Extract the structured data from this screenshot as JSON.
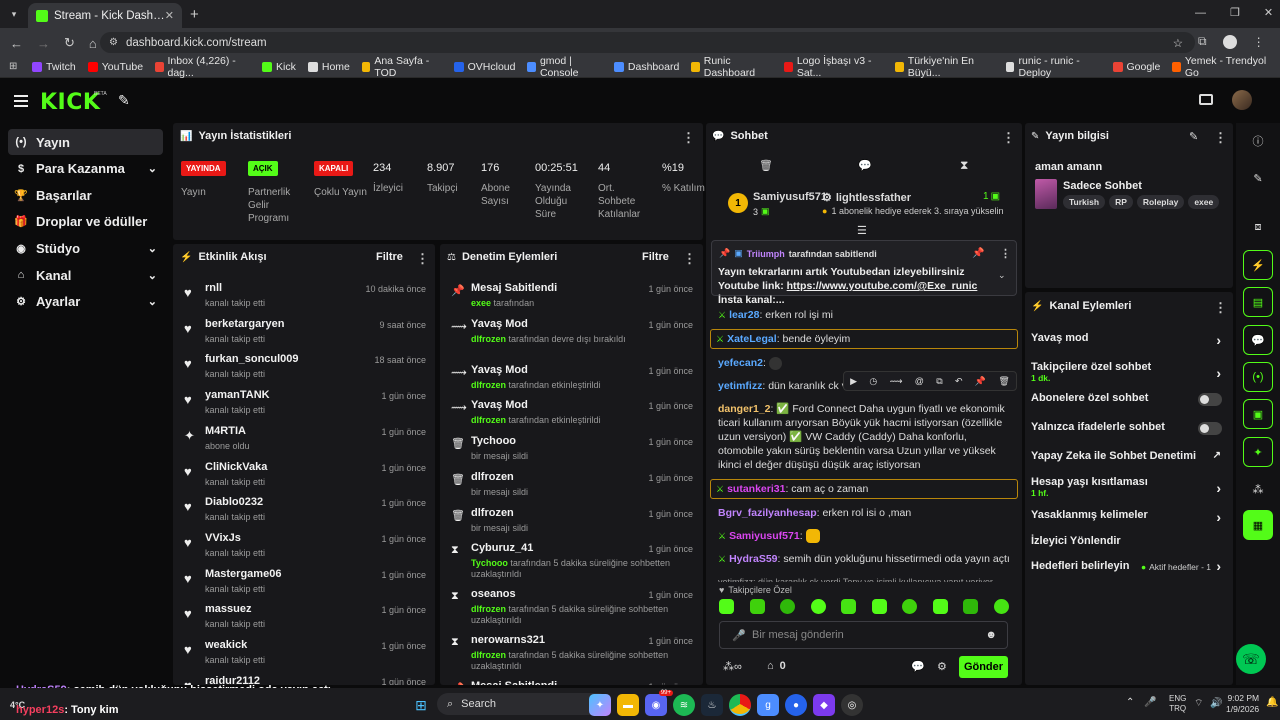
{
  "browser": {
    "tab_title": "Stream - Kick Dashboard",
    "url": "dashboard.kick.com/stream",
    "bookmarks": [
      "Twitch",
      "YouTube",
      "Inbox (4,226) - dag...",
      "Kick",
      "Home",
      "Ana Sayfa - TOD",
      "OVHcloud",
      "gmod | Console",
      "Dashboard",
      "Runic Dashboard",
      "Logo İşbaşı v3 - Sat...",
      "Türkiye'nin En Büyü...",
      "runic - runic - Deploy",
      "Google",
      "Yemek - Trendyol Go"
    ]
  },
  "kick": {
    "logo": "KICK",
    "beta": "BETA"
  },
  "sidebar": {
    "items": [
      {
        "label": "Yayın",
        "icon": "(•)"
      },
      {
        "label": "Para Kazanma",
        "icon": "$"
      },
      {
        "label": "Başarılar",
        "icon": "🏆"
      },
      {
        "label": "Droplar ve ödüller",
        "icon": "🎁"
      },
      {
        "label": "Stüdyo",
        "icon": "◉"
      },
      {
        "label": "Kanal",
        "icon": "⌂"
      },
      {
        "label": "Ayarlar",
        "icon": "⚙"
      }
    ]
  },
  "stats": {
    "title": "Yayın İstatistikleri",
    "badges": [
      {
        "badge": "YAYINDA",
        "label": "Yayın",
        "color": "#e91916",
        "text": "#fff"
      },
      {
        "badge": "AÇIK",
        "label": "Partnerlik Gelir Programı",
        "color": "#53fc18",
        "text": "#000"
      },
      {
        "badge": "KAPALI",
        "label": "Çoklu Yayın",
        "color": "#e91916",
        "text": "#fff"
      }
    ],
    "values": [
      {
        "value": "234",
        "label": "İzleyici"
      },
      {
        "value": "8.907",
        "label": "Takipçi"
      },
      {
        "value": "176",
        "label": "Abone Sayısı"
      },
      {
        "value": "00:25:51",
        "label": "Yayında Olduğu Süre"
      },
      {
        "value": "44",
        "label": "Ort. Sohbete Katılanlar"
      },
      {
        "value": "%19",
        "label": "% Katılım"
      }
    ]
  },
  "activity": {
    "title": "Etkinlik Akışı",
    "filter": "Filtre",
    "items": [
      {
        "name": "rnll",
        "sub": "kanalı takip etti",
        "time": "10 dakika önce"
      },
      {
        "name": "berketargaryen",
        "sub": "kanalı takip etti",
        "time": "9 saat önce"
      },
      {
        "name": "furkan_soncul009",
        "sub": "kanalı takip etti",
        "time": "18 saat önce"
      },
      {
        "name": "yamanTANK",
        "sub": "kanalı takip etti",
        "time": "1 gün önce"
      },
      {
        "name": "M4RTIA",
        "sub": "abone oldu",
        "time": "1 gün önce"
      },
      {
        "name": "CliNickVaka",
        "sub": "kanalı takip etti",
        "time": "1 gün önce"
      },
      {
        "name": "Diablo0232",
        "sub": "kanalı takip etti",
        "time": "1 gün önce"
      },
      {
        "name": "VVixJs",
        "sub": "kanalı takip etti",
        "time": "1 gün önce"
      },
      {
        "name": "Mastergame06",
        "sub": "kanalı takip etti",
        "time": "1 gün önce"
      },
      {
        "name": "massuez",
        "sub": "kanalı takip etti",
        "time": "1 gün önce"
      },
      {
        "name": "weakick",
        "sub": "kanalı takip etti",
        "time": "1 gün önce"
      },
      {
        "name": "raidur2112",
        "sub": "",
        "time": "1 gün önce"
      }
    ]
  },
  "moderation": {
    "title": "Denetim Eylemleri",
    "filter": "Filtre",
    "items": [
      {
        "icon": "pin",
        "title": "Mesaj Sabitlendi",
        "user": "exee",
        "sub": "tarafından",
        "time": "1 gün önce"
      },
      {
        "icon": "slow",
        "title": "Yavaş Mod",
        "user": "dlfrozen",
        "sub": "tarafından devre dışı bırakıldı",
        "time": "1 gün önce"
      },
      {
        "icon": "slow",
        "title": "Yavaş Mod",
        "user": "dlfrozen",
        "sub": "tarafından etkinleştirildi",
        "time": "1 gün önce"
      },
      {
        "icon": "slow",
        "title": "Yavaş Mod",
        "user": "dlfrozen",
        "sub": "tarafından etkinleştirildi",
        "time": "1 gün önce"
      },
      {
        "icon": "trash",
        "title": "Tychooo",
        "user": "",
        "sub": "bir mesajı sildi",
        "time": "1 gün önce"
      },
      {
        "icon": "trash",
        "title": "dlfrozen",
        "user": "",
        "sub": "bir mesajı sildi",
        "time": "1 gün önce"
      },
      {
        "icon": "trash",
        "title": "dlfrozen",
        "user": "",
        "sub": "bir mesajı sildi",
        "time": "1 gün önce"
      },
      {
        "icon": "hour",
        "title": "Cyburuz_41",
        "user": "Tychooo",
        "sub": "tarafından 5 dakika süreliğine sohbetten uzaklaştırıldı",
        "time": "1 gün önce"
      },
      {
        "icon": "hour",
        "title": "oseanos",
        "user": "dlfrozen",
        "sub": "tarafından 5 dakika süreliğine sohbetten uzaklaştırıldı",
        "time": "1 gün önce"
      },
      {
        "icon": "hour",
        "title": "nerowarns321",
        "user": "dlfrozen",
        "sub": "tarafından 5 dakika süreliğine sohbetten uzaklaştırıldı",
        "time": "1 gün önce"
      },
      {
        "icon": "pin",
        "title": "Mesaj Sabitlendi",
        "user": "",
        "sub": "",
        "time": "1 gün önce"
      }
    ]
  },
  "chat": {
    "title": "Sohbet",
    "gift": {
      "rank": "1",
      "user": "Samiyusuf571",
      "count": "3",
      "gifted": "lightlessfather",
      "gcount": "1",
      "text": "1 abonelik hediye ederek 3. sıraya yükselin"
    },
    "pinned": {
      "by": "Triiumph",
      "by_suffix": "tarafından sabitlendi",
      "text": "Yayın tekrarlarını artık Youtubedan izleyebilirsiniz Youtube link: ",
      "link": "https://www.youtube.com/@Exe_runic",
      "tail": " İnsta kanal:..."
    },
    "messages": [
      {
        "user": "lear28",
        "color": "#5aa9ff",
        "text": "erken rol işi mi"
      },
      {
        "user": "XateLegal",
        "color": "#5aa9ff",
        "text": "bende öyleyim"
      },
      {
        "user": "yefecan2",
        "color": "#5aa9ff",
        "text": ""
      },
      {
        "user": "yetimfizz",
        "color": "#5aa9ff",
        "text": "dün karanlık ck verdi"
      },
      {
        "user": "danger1_2",
        "color": "#f2c26b",
        "text": "✅ Ford Connect Daha uygun fiyatlı ve ekonomik ticari kullanım arıyorsan Böyük yük hacmi istiyorsan (özellikle uzun versiyon) ✅ VW Caddy (Caddy) Daha konforlu, otomobile yakın sürüş beklentin varsa Uzun yıllar ve yüksek ikinci el değer düşüşü düşük araç istiyorsan"
      },
      {
        "user": "sutankeri31",
        "color": "#d946ef",
        "text": "cam aç o zaman"
      },
      {
        "user": "Bgrv_fazilyanhesap",
        "color": "#c084fc",
        "text": "erken rol isi o ,man"
      },
      {
        "user": "Samiyusuf571",
        "color": "#d946ef",
        "text": ""
      },
      {
        "user": "HydraS59",
        "color": "#c084fc",
        "text": "semih dün yokluğunu hissetirmedi oda yayın açtı"
      },
      {
        "reply": "yetimfizz: dün karanlık ck verdi Tony ye isimli kullanıcıya yanıt veriyor"
      },
      {
        "user": "hyper12s",
        "color": "#f43f5e",
        "text": "Tony kim"
      }
    ],
    "followers_only": "Takipçilere Özel",
    "input_placeholder": "Bir mesaj gönderin",
    "points": "0",
    "send": "Gönder"
  },
  "stream_info": {
    "title": "Yayın bilgisi",
    "stream_title": "aman amann",
    "category": "Sadece Sohbet",
    "tags": [
      "Turkish",
      "RP",
      "Roleplay",
      "exee"
    ]
  },
  "channel_actions": {
    "title": "Kanal Eylemleri",
    "rows": [
      {
        "label": "Yavaş mod",
        "sub": "",
        "type": "chevron"
      },
      {
        "label": "Takipçilere özel sohbet",
        "sub": "1 dk.",
        "type": "chevron"
      },
      {
        "label": "Abonelere özel sohbet",
        "sub": "",
        "type": "toggle"
      },
      {
        "label": "Yalnızca ifadelerle sohbet",
        "sub": "",
        "type": "toggle"
      },
      {
        "label": "Yapay Zeka ile Sohbet Denetimi",
        "sub": "",
        "type": "ext"
      },
      {
        "label": "Hesap yaşı kısıtlaması",
        "sub": "1 hf.",
        "type": "chevron"
      },
      {
        "label": "Yasaklanmış kelimeler",
        "sub": "",
        "type": "chevron"
      },
      {
        "label": "İzleyici Yönlendir",
        "sub": "",
        "type": "none"
      },
      {
        "label": "Hedefleri belirleyin",
        "sub": "",
        "type": "goal",
        "status": "Aktif hedefler - 1"
      }
    ]
  },
  "overlay": {
    "line1_user": "HydraS59",
    "line1_text": ": semih dün yokluğunu hissetirmedi oda yayın açtı",
    "line2_user": "hyper12s",
    "line2_text": ": Tony kim",
    "temp": "4°C"
  },
  "taskbar": {
    "search": "Search",
    "lang1": "ENG",
    "lang2": "TRQ",
    "time": "9:02 PM",
    "date": "1/9/2026",
    "badge": "99+"
  }
}
